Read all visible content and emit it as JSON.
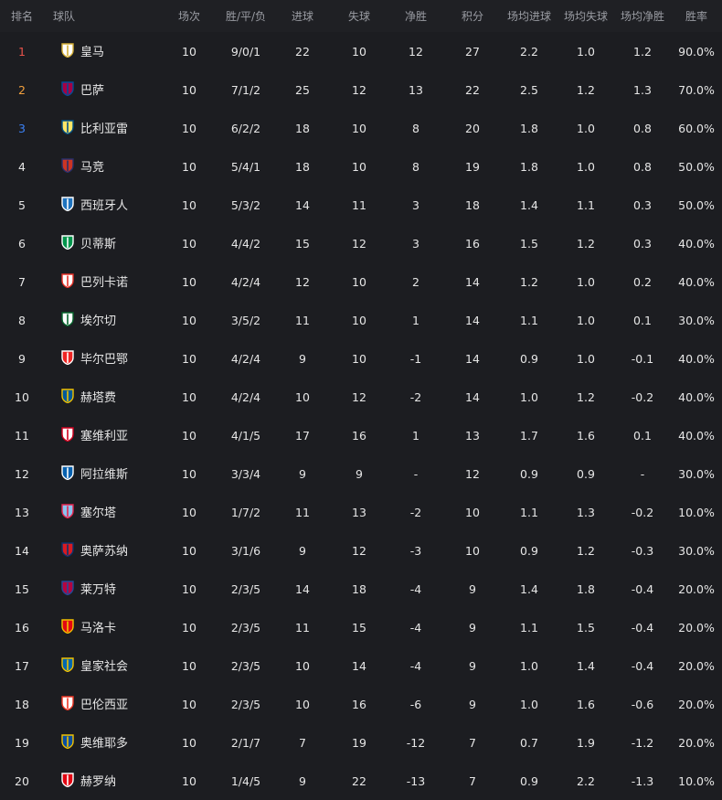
{
  "headers": {
    "rank": "排名",
    "team": "球队",
    "played": "场次",
    "wdl": "胜/平/负",
    "goals_for": "进球",
    "goals_against": "失球",
    "goal_diff": "净胜",
    "points": "积分",
    "avg_gf": "场均进球",
    "avg_ga": "场均失球",
    "avg_gd": "场均净胜",
    "win_rate": "胜率"
  },
  "rows": [
    {
      "rank": "1",
      "team": "皇马",
      "crest": "real-madrid-crest-icon",
      "c1": "#ffffff",
      "c2": "#d4af37",
      "played": "10",
      "wdl": "9/0/1",
      "gf": "22",
      "ga": "10",
      "gd": "12",
      "pts": "27",
      "avg_gf": "2.2",
      "avg_ga": "1.0",
      "avg_gd": "1.2",
      "win": "90.0%"
    },
    {
      "rank": "2",
      "team": "巴萨",
      "crest": "barcelona-crest-icon",
      "c1": "#a50044",
      "c2": "#004d98",
      "played": "10",
      "wdl": "7/1/2",
      "gf": "25",
      "ga": "12",
      "gd": "13",
      "pts": "22",
      "avg_gf": "2.5",
      "avg_ga": "1.2",
      "avg_gd": "1.3",
      "win": "70.0%"
    },
    {
      "rank": "3",
      "team": "比利亚雷",
      "crest": "villarreal-crest-icon",
      "c1": "#ffe667",
      "c2": "#005187",
      "played": "10",
      "wdl": "6/2/2",
      "gf": "18",
      "ga": "10",
      "gd": "8",
      "pts": "20",
      "avg_gf": "1.8",
      "avg_ga": "1.0",
      "avg_gd": "0.8",
      "win": "60.0%"
    },
    {
      "rank": "4",
      "team": "马竞",
      "crest": "atletico-crest-icon",
      "c1": "#cb3524",
      "c2": "#27306b",
      "played": "10",
      "wdl": "5/4/1",
      "gf": "18",
      "ga": "10",
      "gd": "8",
      "pts": "19",
      "avg_gf": "1.8",
      "avg_ga": "1.0",
      "avg_gd": "0.8",
      "win": "50.0%"
    },
    {
      "rank": "5",
      "team": "西班牙人",
      "crest": "espanyol-crest-icon",
      "c1": "#1e73be",
      "c2": "#ffffff",
      "played": "10",
      "wdl": "5/3/2",
      "gf": "14",
      "ga": "11",
      "gd": "3",
      "pts": "18",
      "avg_gf": "1.4",
      "avg_ga": "1.1",
      "avg_gd": "0.3",
      "win": "50.0%"
    },
    {
      "rank": "6",
      "team": "贝蒂斯",
      "crest": "betis-crest-icon",
      "c1": "#00954c",
      "c2": "#ffffff",
      "played": "10",
      "wdl": "4/4/2",
      "gf": "15",
      "ga": "12",
      "gd": "3",
      "pts": "16",
      "avg_gf": "1.5",
      "avg_ga": "1.2",
      "avg_gd": "0.3",
      "win": "40.0%"
    },
    {
      "rank": "7",
      "team": "巴列卡诺",
      "crest": "rayo-crest-icon",
      "c1": "#ffffff",
      "c2": "#e53027",
      "played": "10",
      "wdl": "4/2/4",
      "gf": "12",
      "ga": "10",
      "gd": "2",
      "pts": "14",
      "avg_gf": "1.2",
      "avg_ga": "1.0",
      "avg_gd": "0.2",
      "win": "40.0%"
    },
    {
      "rank": "8",
      "team": "埃尔切",
      "crest": "elche-crest-icon",
      "c1": "#ffffff",
      "c2": "#05642c",
      "played": "10",
      "wdl": "3/5/2",
      "gf": "11",
      "ga": "10",
      "gd": "1",
      "pts": "14",
      "avg_gf": "1.1",
      "avg_ga": "1.0",
      "avg_gd": "0.1",
      "win": "30.0%"
    },
    {
      "rank": "9",
      "team": "毕尔巴鄂",
      "crest": "athletic-crest-icon",
      "c1": "#ee2523",
      "c2": "#ffffff",
      "played": "10",
      "wdl": "4/2/4",
      "gf": "9",
      "ga": "10",
      "gd": "-1",
      "pts": "14",
      "avg_gf": "0.9",
      "avg_ga": "1.0",
      "avg_gd": "-0.1",
      "win": "40.0%"
    },
    {
      "rank": "10",
      "team": "赫塔费",
      "crest": "getafe-crest-icon",
      "c1": "#005999",
      "c2": "#f2c200",
      "played": "10",
      "wdl": "4/2/4",
      "gf": "10",
      "ga": "12",
      "gd": "-2",
      "pts": "14",
      "avg_gf": "1.0",
      "avg_ga": "1.2",
      "avg_gd": "-0.2",
      "win": "40.0%"
    },
    {
      "rank": "11",
      "team": "塞维利亚",
      "crest": "sevilla-crest-icon",
      "c1": "#ffffff",
      "c2": "#d4001f",
      "played": "10",
      "wdl": "4/1/5",
      "gf": "17",
      "ga": "16",
      "gd": "1",
      "pts": "13",
      "avg_gf": "1.7",
      "avg_ga": "1.6",
      "avg_gd": "0.1",
      "win": "40.0%"
    },
    {
      "rank": "12",
      "team": "阿拉维斯",
      "crest": "alaves-crest-icon",
      "c1": "#0761af",
      "c2": "#ffffff",
      "played": "10",
      "wdl": "3/3/4",
      "gf": "9",
      "ga": "9",
      "gd": "-",
      "pts": "12",
      "avg_gf": "0.9",
      "avg_ga": "0.9",
      "avg_gd": "-",
      "win": "30.0%"
    },
    {
      "rank": "13",
      "team": "塞尔塔",
      "crest": "celta-crest-icon",
      "c1": "#8ac3ee",
      "c2": "#e5254e",
      "played": "10",
      "wdl": "1/7/2",
      "gf": "11",
      "ga": "13",
      "gd": "-2",
      "pts": "10",
      "avg_gf": "1.1",
      "avg_ga": "1.3",
      "avg_gd": "-0.2",
      "win": "10.0%"
    },
    {
      "rank": "14",
      "team": "奥萨苏纳",
      "crest": "osasuna-crest-icon",
      "c1": "#d91a21",
      "c2": "#0a346f",
      "played": "10",
      "wdl": "3/1/6",
      "gf": "9",
      "ga": "12",
      "gd": "-3",
      "pts": "10",
      "avg_gf": "0.9",
      "avg_ga": "1.2",
      "avg_gd": "-0.3",
      "win": "30.0%"
    },
    {
      "rank": "15",
      "team": "莱万特",
      "crest": "levante-crest-icon",
      "c1": "#b4053f",
      "c2": "#1f4b9a",
      "played": "10",
      "wdl": "2/3/5",
      "gf": "14",
      "ga": "18",
      "gd": "-4",
      "pts": "9",
      "avg_gf": "1.4",
      "avg_ga": "1.8",
      "avg_gd": "-0.4",
      "win": "20.0%"
    },
    {
      "rank": "16",
      "team": "马洛卡",
      "crest": "mallorca-crest-icon",
      "c1": "#e20613",
      "c2": "#f2c200",
      "played": "10",
      "wdl": "2/3/5",
      "gf": "11",
      "ga": "15",
      "gd": "-4",
      "pts": "9",
      "avg_gf": "1.1",
      "avg_ga": "1.5",
      "avg_gd": "-0.4",
      "win": "20.0%"
    },
    {
      "rank": "17",
      "team": "皇家社会",
      "crest": "real-sociedad-crest-icon",
      "c1": "#0067b1",
      "c2": "#f2c200",
      "played": "10",
      "wdl": "2/3/5",
      "gf": "10",
      "ga": "14",
      "gd": "-4",
      "pts": "9",
      "avg_gf": "1.0",
      "avg_ga": "1.4",
      "avg_gd": "-0.4",
      "win": "20.0%"
    },
    {
      "rank": "18",
      "team": "巴伦西亚",
      "crest": "valencia-crest-icon",
      "c1": "#ffffff",
      "c2": "#ee3524",
      "played": "10",
      "wdl": "2/3/5",
      "gf": "10",
      "ga": "16",
      "gd": "-6",
      "pts": "9",
      "avg_gf": "1.0",
      "avg_ga": "1.6",
      "avg_gd": "-0.6",
      "win": "20.0%"
    },
    {
      "rank": "19",
      "team": "奥维耶多",
      "crest": "oviedo-crest-icon",
      "c1": "#0a4ea1",
      "c2": "#f2c200",
      "played": "10",
      "wdl": "2/1/7",
      "gf": "7",
      "ga": "19",
      "gd": "-12",
      "pts": "7",
      "avg_gf": "0.7",
      "avg_ga": "1.9",
      "avg_gd": "-1.2",
      "win": "20.0%"
    },
    {
      "rank": "20",
      "team": "赫罗纳",
      "crest": "girona-crest-icon",
      "c1": "#e30613",
      "c2": "#ffffff",
      "played": "10",
      "wdl": "1/4/5",
      "gf": "9",
      "ga": "22",
      "gd": "-13",
      "pts": "7",
      "avg_gf": "0.9",
      "avg_ga": "2.2",
      "avg_gd": "-1.3",
      "win": "10.0%"
    }
  ]
}
